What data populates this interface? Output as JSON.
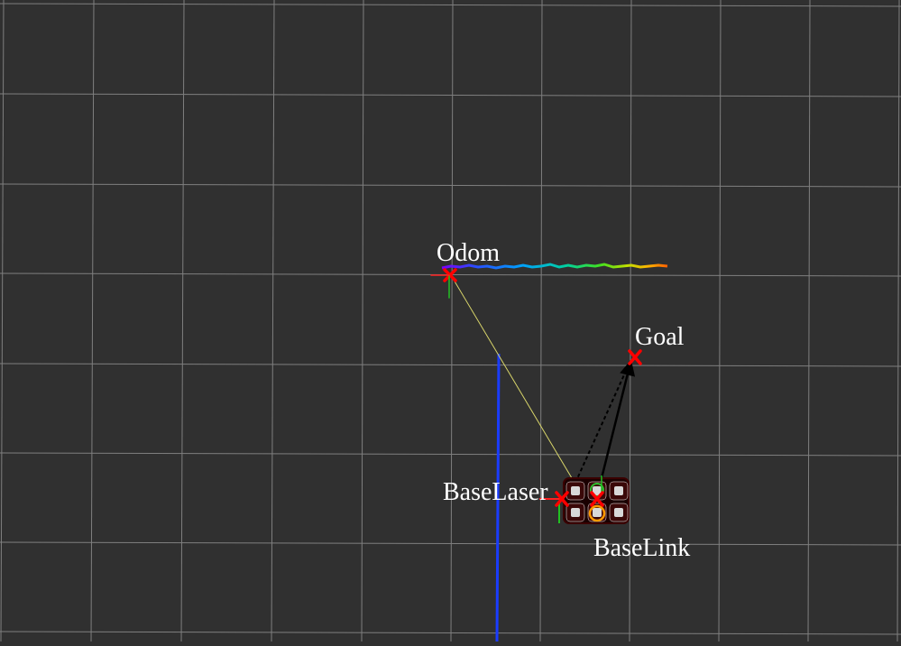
{
  "scene": {
    "labels": {
      "odom": "Odom",
      "goal": "Goal",
      "base_laser": "BaseLaser",
      "base_link": "BaseLink"
    },
    "colors": {
      "background": "#303030",
      "grid": "#a0a0a0",
      "frame_marker": "#ff0000",
      "tf_link": "#d8d56a",
      "laser_scan": "#1a3cff",
      "path_arrow": "#000000",
      "label_text": "#ffffff"
    },
    "odom_trail_gradient": [
      "#7a00ff",
      "#2a4dff",
      "#00a0ff",
      "#00d0a0",
      "#40e020",
      "#c0e000",
      "#ffb000",
      "#ff6000"
    ]
  }
}
